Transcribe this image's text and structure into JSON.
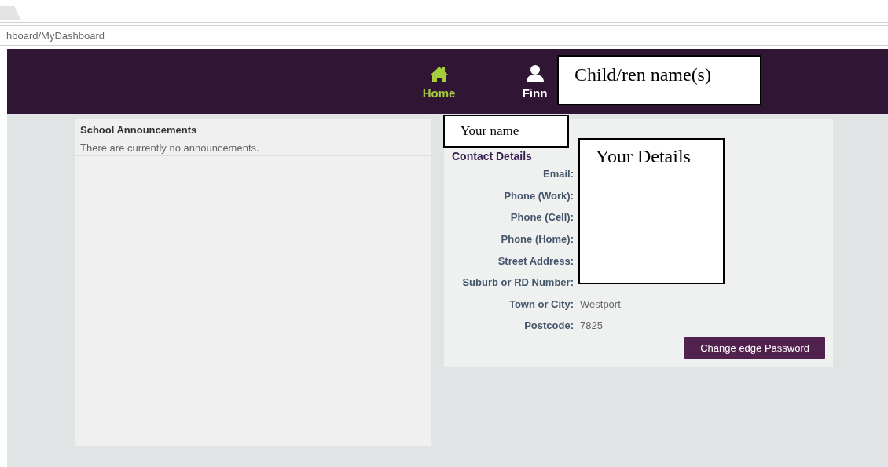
{
  "browser": {
    "address": "hboard/MyDashboard"
  },
  "nav": [
    {
      "label": "Home",
      "kind": "home",
      "selected": true
    },
    {
      "label": "Finn",
      "kind": "person",
      "selected": false
    }
  ],
  "announcements": {
    "title": "School Announcements",
    "message": "There are currently no announcements."
  },
  "contact": {
    "heading": "Contact Details",
    "fields": [
      {
        "label": "Email:"
      },
      {
        "label": "Phone (Work):"
      },
      {
        "label": "Phone (Cell):"
      },
      {
        "label": "Phone (Home):"
      },
      {
        "label": "Street Address:"
      },
      {
        "label": "Suburb or RD Number:"
      },
      {
        "label": "Town or City:",
        "value": "Westport"
      },
      {
        "label": "Postcode:",
        "value": "7825"
      }
    ]
  },
  "button": "Change edge Password",
  "annotations": [
    {
      "text": "Child/ren name(s)",
      "kind": "children"
    },
    {
      "text": "Your name",
      "kind": "name"
    },
    {
      "text": "Your Details",
      "kind": "details"
    }
  ]
}
